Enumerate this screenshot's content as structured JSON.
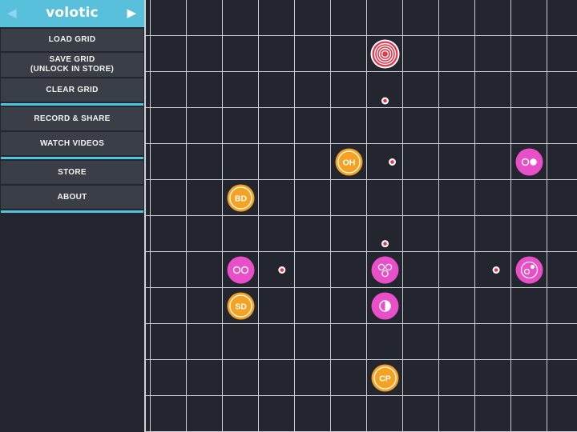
{
  "app": {
    "title": "volotic",
    "prev_arrow": "◀",
    "next_arrow": "▶"
  },
  "menu": {
    "load_grid": "LOAD GRID",
    "save_grid_line1": "SAVE GRID",
    "save_grid_line2": "(UNLOCK IN STORE)",
    "clear_grid": "CLEAR GRID",
    "record_share": "RECORD & SHARE",
    "watch_videos": "WATCH VIDEOS",
    "store": "STORE",
    "about": "ABOUT"
  },
  "colors": {
    "accent": "#59c0dc",
    "separator": "#4fc3e0",
    "background": "#23262e",
    "button": "#3a3e47",
    "grid_line": "#c9ccd2",
    "pink_node": "#e84fc8",
    "orange_node": "#f4a223",
    "target_node": "#e8354b",
    "pulse": "#e8354b"
  },
  "grid": {
    "columns": 12,
    "rows": 12,
    "nodes": [
      {
        "id": "target",
        "type": "target",
        "col": 6,
        "row": 1
      },
      {
        "id": "oh",
        "type": "orange-label",
        "label": "OH",
        "col": 5,
        "row": 4
      },
      {
        "id": "bd",
        "type": "orange-label",
        "label": "BD",
        "col": 2,
        "row": 5
      },
      {
        "id": "sd",
        "type": "orange-label",
        "label": "SD",
        "col": 2,
        "row": 8
      },
      {
        "id": "cp",
        "type": "orange-label",
        "label": "CP",
        "col": 6,
        "row": 10
      },
      {
        "id": "pink-right-4",
        "type": "pink-dots-filled",
        "col": 10,
        "row": 4
      },
      {
        "id": "pink-left-7",
        "type": "pink-two-dots",
        "col": 2,
        "row": 7
      },
      {
        "id": "pink-center-7",
        "type": "pink-three-dots",
        "col": 6,
        "row": 7
      },
      {
        "id": "pink-right-7",
        "type": "pink-cycle",
        "col": 10,
        "row": 7
      },
      {
        "id": "pink-half-8",
        "type": "pink-half",
        "col": 6,
        "row": 8
      }
    ],
    "pulses": [
      {
        "col": 6,
        "row": 2,
        "dx": 0,
        "dy": 0.3
      },
      {
        "col": 6,
        "row": 4,
        "dx": 0.2,
        "dy": 0
      },
      {
        "col": 6,
        "row": 6,
        "dx": 0,
        "dy": 0.27
      },
      {
        "col": 3,
        "row": 7,
        "dx": 0.14,
        "dy": 0
      },
      {
        "col": 9,
        "row": 7,
        "dx": 0.08,
        "dy": 0
      }
    ]
  }
}
